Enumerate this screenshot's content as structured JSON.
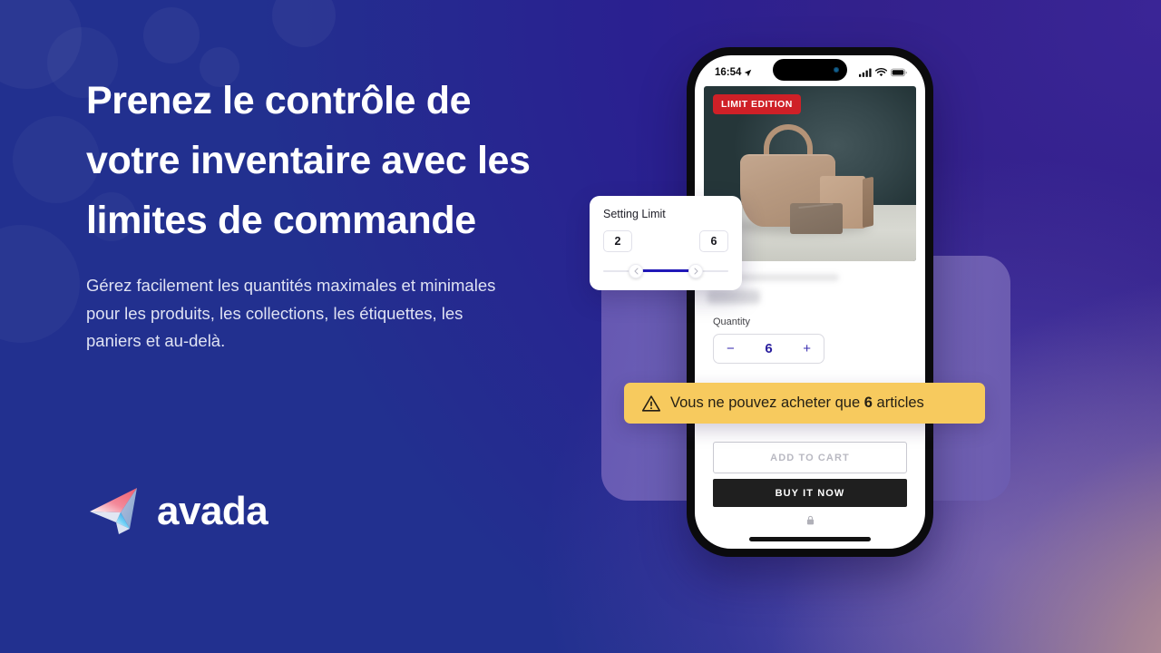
{
  "hero": {
    "headline": "Prenez le contrôle de votre inventaire avec les limites de commande",
    "subhead": "Gérez facilement les quantités maximales et minimales pour les produits, les collections, les étiquettes, les paniers et au-delà."
  },
  "brand": {
    "name": "avada",
    "logo_icon": "paper-plane-icon",
    "logo_colors": {
      "pink": "#f2788a",
      "red": "#ef5f6e",
      "cyan": "#35c0f0",
      "blue": "#2d8fe0"
    }
  },
  "colors": {
    "bg_left": "#1279c4",
    "bg_topright": "#33218c",
    "bg_bottomright": "#e2af96",
    "panel_purple": "#7468bb",
    "accent_indigo": "#2118b8",
    "warning_yellow": "#f7ca5e",
    "badge_red": "#cf2027"
  },
  "phone": {
    "statusbar": {
      "time": "16:54",
      "location_icon": "location-arrow-icon",
      "signal_icon": "cellular-signal-icon",
      "wifi_icon": "wifi-icon",
      "battery_icon": "battery-icon",
      "dynamic_island": "dynamic-island",
      "camera_icon": "front-camera-icon"
    },
    "product": {
      "badge": "LIMIT EDITION",
      "image_alt": "beige-handbag-with-wallets",
      "title_blurred": true,
      "price_blurred": true
    },
    "quantity": {
      "label": "Quantity",
      "value": "6",
      "decrement": "−",
      "increment": "+"
    },
    "actions": {
      "add_to_cart": "ADD TO CART",
      "buy_it_now": "BUY IT NOW",
      "secure_icon": "lock-icon"
    },
    "home_indicator": "home-indicator"
  },
  "limit_card": {
    "title": "Setting Limit",
    "min_value": "2",
    "max_value": "6",
    "slider": {
      "left_handle_icon": "chevron-left-icon",
      "right_handle_icon": "chevron-right-icon",
      "fill_color": "#2118b8"
    }
  },
  "warning": {
    "icon": "warning-triangle-icon",
    "text_before": "Vous ne pouvez acheter que ",
    "highlight": "6",
    "text_after": " articles"
  }
}
